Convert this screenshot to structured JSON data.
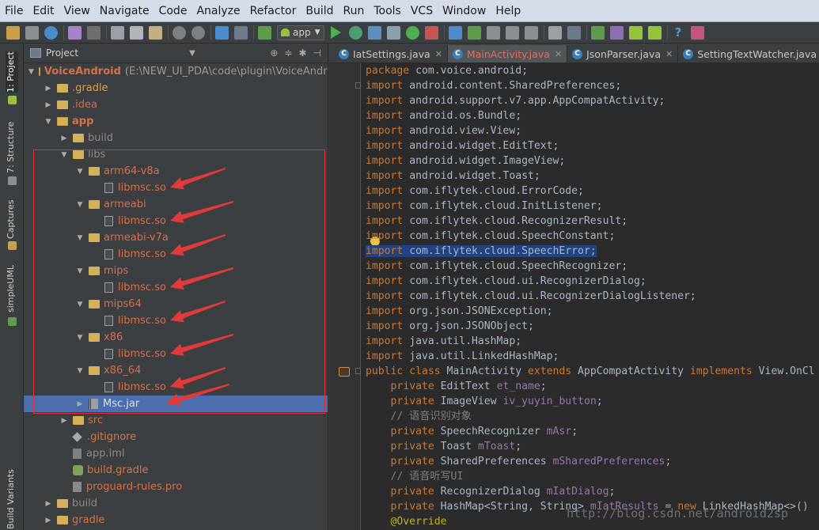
{
  "menu": [
    "File",
    "Edit",
    "View",
    "Navigate",
    "Code",
    "Analyze",
    "Refactor",
    "Build",
    "Run",
    "Tools",
    "VCS",
    "Window",
    "Help"
  ],
  "toolbar": {
    "run_config": "app"
  },
  "left_tabs": {
    "project": "1: Project",
    "structure": "7: Structure",
    "captures": "Captures",
    "simpleuml": "simpleUML",
    "build_variants": "Build Variants"
  },
  "project_panel": {
    "title": "Project"
  },
  "tree": [
    {
      "label": "VoiceAndroid",
      "path": "(E:\\NEW_UI_PDA\\code\\plugin\\VoiceAndroi",
      "depth": 0,
      "arrow": "open",
      "icon": "module-folder",
      "style": "red bold"
    },
    {
      "label": ".gradle",
      "depth": 1,
      "arrow": "closed",
      "icon": "folder",
      "style": "yellow"
    },
    {
      "label": ".idea",
      "depth": 1,
      "arrow": "closed",
      "icon": "folder",
      "style": "red"
    },
    {
      "label": "app",
      "depth": 1,
      "arrow": "open",
      "icon": "module-folder",
      "style": "red bold"
    },
    {
      "label": "build",
      "depth": 2,
      "arrow": "closed",
      "icon": "folder",
      "style": "gray"
    },
    {
      "label": "libs",
      "depth": 2,
      "arrow": "open",
      "icon": "folder",
      "style": "gray"
    },
    {
      "label": "arm64-v8a",
      "depth": 3,
      "arrow": "open",
      "icon": "folder",
      "style": "red"
    },
    {
      "label": "libmsc.so",
      "depth": 4,
      "arrow": "none",
      "icon": "so",
      "style": "red"
    },
    {
      "label": "armeabi",
      "depth": 3,
      "arrow": "open",
      "icon": "folder",
      "style": "red"
    },
    {
      "label": "libmsc.so",
      "depth": 4,
      "arrow": "none",
      "icon": "so",
      "style": "red"
    },
    {
      "label": "armeabi-v7a",
      "depth": 3,
      "arrow": "open",
      "icon": "folder",
      "style": "red"
    },
    {
      "label": "libmsc.so",
      "depth": 4,
      "arrow": "none",
      "icon": "so",
      "style": "red"
    },
    {
      "label": "mips",
      "depth": 3,
      "arrow": "open",
      "icon": "folder",
      "style": "red"
    },
    {
      "label": "libmsc.so",
      "depth": 4,
      "arrow": "none",
      "icon": "so",
      "style": "red"
    },
    {
      "label": "mips64",
      "depth": 3,
      "arrow": "open",
      "icon": "folder",
      "style": "red"
    },
    {
      "label": "libmsc.so",
      "depth": 4,
      "arrow": "none",
      "icon": "so",
      "style": "red"
    },
    {
      "label": "x86",
      "depth": 3,
      "arrow": "open",
      "icon": "folder",
      "style": "red"
    },
    {
      "label": "libmsc.so",
      "depth": 4,
      "arrow": "none",
      "icon": "so",
      "style": "red"
    },
    {
      "label": "x86_64",
      "depth": 3,
      "arrow": "open",
      "icon": "folder",
      "style": "red"
    },
    {
      "label": "libmsc.so",
      "depth": 4,
      "arrow": "none",
      "icon": "so",
      "style": "red"
    },
    {
      "label": "Msc.jar",
      "depth": 3,
      "arrow": "closed",
      "icon": "jar",
      "style": "white",
      "selected": true
    },
    {
      "label": "src",
      "depth": 2,
      "arrow": "closed",
      "icon": "folder",
      "style": "red"
    },
    {
      "label": ".gitignore",
      "depth": 2,
      "arrow": "none",
      "icon": "git",
      "style": "orange"
    },
    {
      "label": "app.iml",
      "depth": 2,
      "arrow": "none",
      "icon": "iml",
      "style": "gray"
    },
    {
      "label": "build.gradle",
      "depth": 2,
      "arrow": "none",
      "icon": "gradle",
      "style": "orange"
    },
    {
      "label": "proguard-rules.pro",
      "depth": 2,
      "arrow": "none",
      "icon": "pro",
      "style": "red"
    },
    {
      "label": "build",
      "depth": 1,
      "arrow": "closed",
      "icon": "folder",
      "style": "gray"
    },
    {
      "label": "gradle",
      "depth": 1,
      "arrow": "closed",
      "icon": "folder",
      "style": "red"
    }
  ],
  "editor_tabs": [
    {
      "label": "IatSettings.java",
      "active": false
    },
    {
      "label": "MainActivity.java",
      "active": true
    },
    {
      "label": "JsonParser.java",
      "active": false
    },
    {
      "label": "SettingTextWatcher.java",
      "active": false
    }
  ],
  "code": [
    [
      [
        "kw",
        "package "
      ],
      [
        "pl",
        "com.voice.android;"
      ]
    ],
    [
      [
        "kw",
        "import "
      ],
      [
        "pl",
        "android.content.SharedPreferences;"
      ]
    ],
    [
      [
        "kw",
        "import "
      ],
      [
        "pl",
        "android.support.v7.app.AppCompatActivity;"
      ]
    ],
    [
      [
        "kw",
        "import "
      ],
      [
        "pl",
        "android.os.Bundle;"
      ]
    ],
    [
      [
        "kw",
        "import "
      ],
      [
        "pl",
        "android.view.View;"
      ]
    ],
    [
      [
        "kw",
        "import "
      ],
      [
        "pl",
        "android.widget.EditText;"
      ]
    ],
    [
      [
        "kw",
        "import "
      ],
      [
        "pl",
        "android.widget.ImageView;"
      ]
    ],
    [
      [
        "kw",
        "import "
      ],
      [
        "pl",
        "android.widget.Toast;"
      ]
    ],
    [
      [
        "kw",
        "import "
      ],
      [
        "pl",
        "com.iflytek.cloud.ErrorCode;"
      ]
    ],
    [
      [
        "kw",
        "import "
      ],
      [
        "pl",
        "com.iflytek.cloud.InitListener;"
      ]
    ],
    [
      [
        "kw",
        "import "
      ],
      [
        "pl",
        "com.iflytek.cloud.RecognizerResult;"
      ]
    ],
    [
      [
        "kw",
        "import "
      ],
      [
        "pl",
        "com.iflytek.cloud.SpeechConstant;"
      ]
    ],
    [
      [
        "kw hl",
        "import "
      ],
      [
        "pl hl",
        "com.iflytek.cloud.SpeechError;"
      ]
    ],
    [
      [
        "kw",
        "import "
      ],
      [
        "pl",
        "com.iflytek.cloud.SpeechRecognizer;"
      ]
    ],
    [
      [
        "kw",
        "import "
      ],
      [
        "pl",
        "com.iflytek.cloud.ui.RecognizerDialog;"
      ]
    ],
    [
      [
        "kw",
        "import "
      ],
      [
        "pl",
        "com.iflytek.cloud.ui.RecognizerDialogListener;"
      ]
    ],
    [
      [
        "kw",
        "import "
      ],
      [
        "pl",
        "org.json.JSONException;"
      ]
    ],
    [
      [
        "kw",
        "import "
      ],
      [
        "pl",
        "org.json.JSONObject;"
      ]
    ],
    [
      [
        "kw",
        "import "
      ],
      [
        "pl",
        "java.util.HashMap;"
      ]
    ],
    [
      [
        "kw",
        "import "
      ],
      [
        "pl",
        "java.util.LinkedHashMap;"
      ]
    ],
    [
      [
        "kw",
        "public class "
      ],
      [
        "pl",
        "MainActivity "
      ],
      [
        "kw",
        "extends "
      ],
      [
        "pl",
        "AppCompatActivity "
      ],
      [
        "kw",
        "implements "
      ],
      [
        "pl",
        "View.OnCl"
      ]
    ],
    [
      [
        "pl",
        "    "
      ],
      [
        "kw",
        "private "
      ],
      [
        "pl",
        "EditText "
      ],
      [
        "fd",
        "et_name"
      ],
      [
        "pl",
        ";"
      ]
    ],
    [
      [
        "pl",
        "    "
      ],
      [
        "kw",
        "private "
      ],
      [
        "pl",
        "ImageView "
      ],
      [
        "fd",
        "iv_yuyin_button"
      ],
      [
        "pl",
        ";"
      ]
    ],
    [
      [
        "cm",
        "    // 语音识别对象"
      ]
    ],
    [
      [
        "pl",
        "    "
      ],
      [
        "kw",
        "private "
      ],
      [
        "pl",
        "SpeechRecognizer "
      ],
      [
        "fd",
        "mAsr"
      ],
      [
        "pl",
        ";"
      ]
    ],
    [
      [
        "pl",
        "    "
      ],
      [
        "kw",
        "private "
      ],
      [
        "pl",
        "Toast "
      ],
      [
        "fd",
        "mToast"
      ],
      [
        "pl",
        ";"
      ]
    ],
    [
      [
        "pl",
        "    "
      ],
      [
        "kw",
        "private "
      ],
      [
        "pl",
        "SharedPreferences "
      ],
      [
        "fd",
        "mSharedPreferences"
      ],
      [
        "pl",
        ";"
      ]
    ],
    [
      [
        "cm",
        "    // 语音听写UI"
      ]
    ],
    [
      [
        "pl",
        "    "
      ],
      [
        "kw",
        "private "
      ],
      [
        "pl",
        "RecognizerDialog "
      ],
      [
        "fd",
        "mIatDialog"
      ],
      [
        "pl",
        ";"
      ]
    ],
    [
      [
        "pl",
        "    "
      ],
      [
        "kw",
        "private "
      ],
      [
        "pl",
        "HashMap<String, String> "
      ],
      [
        "fd",
        "mIatResults "
      ],
      [
        "pl",
        "= "
      ],
      [
        "kw",
        "new "
      ],
      [
        "pl",
        "LinkedHashMap<>()"
      ]
    ],
    [
      [
        "an",
        "    @Override"
      ]
    ]
  ],
  "watermark": "http://blog.csdn.net/android2sp"
}
